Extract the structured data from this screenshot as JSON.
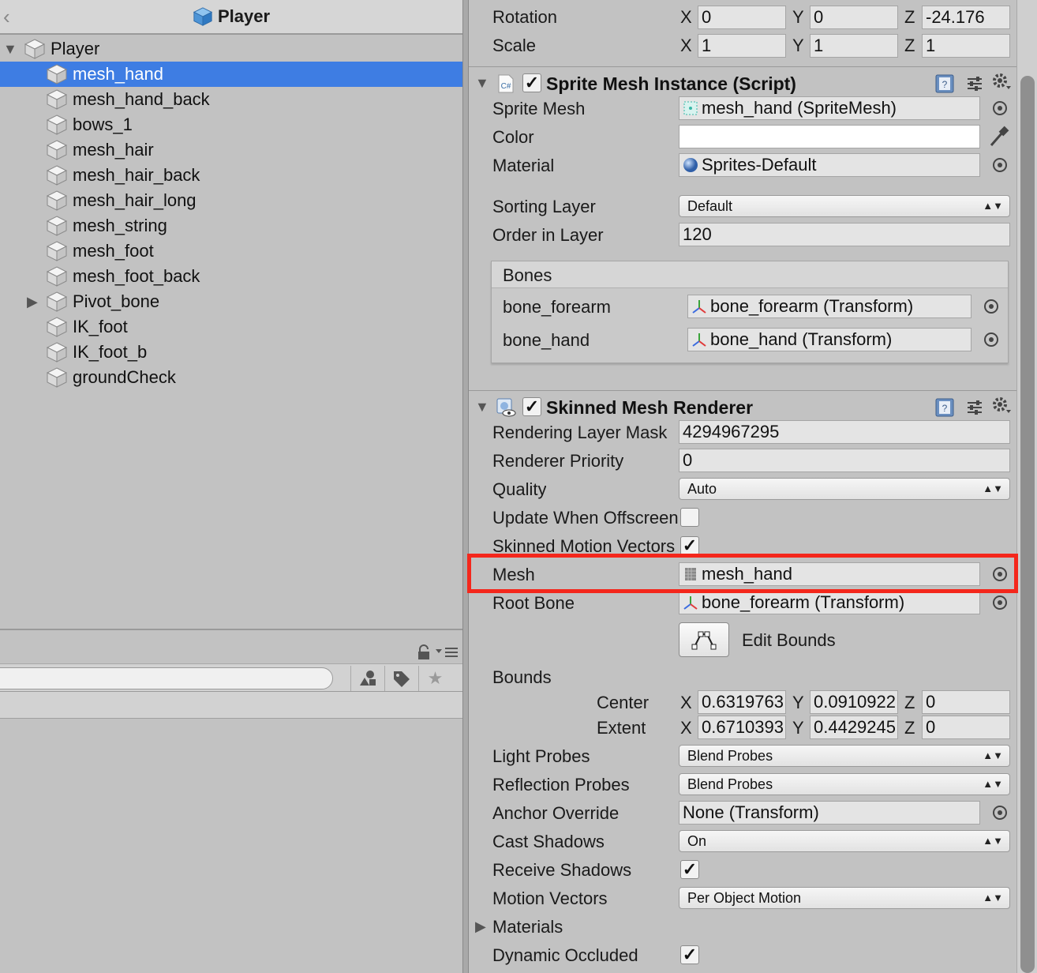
{
  "hierarchy": {
    "title": "Player",
    "root": "Player",
    "items": [
      {
        "label": "mesh_hand",
        "selected": true
      },
      {
        "label": "mesh_hand_back"
      },
      {
        "label": "bows_1"
      },
      {
        "label": "mesh_hair"
      },
      {
        "label": "mesh_hair_back"
      },
      {
        "label": "mesh_hair_long"
      },
      {
        "label": "mesh_string"
      },
      {
        "label": "mesh_foot"
      },
      {
        "label": "mesh_foot_back"
      },
      {
        "label": "Pivot_bone",
        "expandable": true
      },
      {
        "label": "IK_foot"
      },
      {
        "label": "IK_foot_b"
      },
      {
        "label": "groundCheck"
      }
    ]
  },
  "transform": {
    "rotation_label": "Rotation",
    "scale_label": "Scale",
    "rotation": {
      "x": "0",
      "y": "0",
      "z": "-24.176"
    },
    "scale": {
      "x": "1",
      "y": "1",
      "z": "1"
    }
  },
  "axes": {
    "x": "X",
    "y": "Y",
    "z": "Z"
  },
  "sprite_mesh_instance": {
    "title": "Sprite Mesh Instance (Script)",
    "sprite_mesh_label": "Sprite Mesh",
    "sprite_mesh_value": "mesh_hand (SpriteMesh)",
    "color_label": "Color",
    "material_label": "Material",
    "material_value": "Sprites-Default",
    "sorting_layer_label": "Sorting Layer",
    "sorting_layer_value": "Default",
    "order_label": "Order in Layer",
    "order_value": "120",
    "bones_header": "Bones",
    "bones": [
      {
        "name": "bone_forearm",
        "value": "bone_forearm (Transform)"
      },
      {
        "name": "bone_hand",
        "value": "bone_hand (Transform)"
      }
    ]
  },
  "skinned_mesh_renderer": {
    "title": "Skinned Mesh Renderer",
    "rendering_layer_mask_label": "Rendering Layer Mask",
    "rendering_layer_mask_value": "4294967295",
    "renderer_priority_label": "Renderer Priority",
    "renderer_priority_value": "0",
    "quality_label": "Quality",
    "quality_value": "Auto",
    "update_offscreen_label": "Update When Offscreen",
    "skinned_motion_label": "Skinned Motion Vectors",
    "mesh_label": "Mesh",
    "mesh_value": "mesh_hand",
    "root_bone_label": "Root Bone",
    "root_bone_value": "bone_forearm (Transform)",
    "edit_bounds_label": "Edit Bounds",
    "bounds_label": "Bounds",
    "center_label": "Center",
    "center": {
      "x": "0.6319763",
      "y": "0.0910922",
      "z": "0"
    },
    "extent_label": "Extent",
    "extent": {
      "x": "0.6710393",
      "y": "0.4429245",
      "z": "0"
    },
    "light_probes_label": "Light Probes",
    "light_probes_value": "Blend Probes",
    "reflection_probes_label": "Reflection Probes",
    "reflection_probes_value": "Blend Probes",
    "anchor_override_label": "Anchor Override",
    "anchor_override_value": "None (Transform)",
    "cast_shadows_label": "Cast Shadows",
    "cast_shadows_value": "On",
    "receive_shadows_label": "Receive Shadows",
    "motion_vectors_label": "Motion Vectors",
    "motion_vectors_value": "Per Object Motion",
    "materials_label": "Materials",
    "dynamic_occluded_label": "Dynamic Occluded"
  },
  "colors": {
    "selection": "#3e7de3",
    "highlight": "#f4271c"
  }
}
